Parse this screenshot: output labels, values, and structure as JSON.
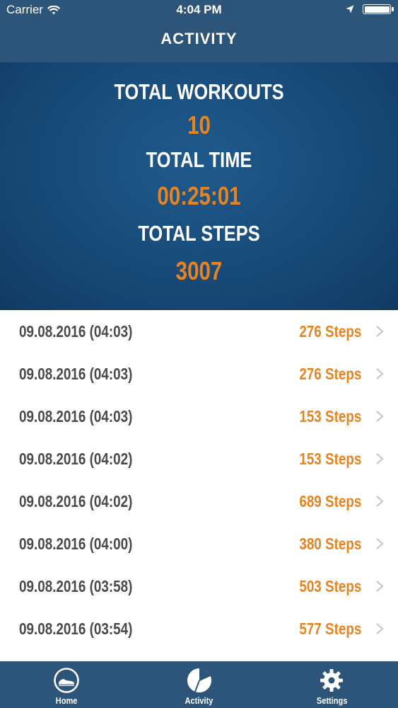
{
  "status_bar": {
    "carrier": "Carrier",
    "time": "4:04 PM"
  },
  "nav": {
    "title": "ACTIVITY"
  },
  "summary": {
    "total_workouts_label": "TOTAL WORKOUTS",
    "total_workouts_value": "10",
    "total_time_label": "TOTAL TIME",
    "total_time_value": "00:25:01",
    "total_steps_label": "TOTAL STEPS",
    "total_steps_value": "3007"
  },
  "workouts": [
    {
      "date": "09.08.2016 (04:03)",
      "steps": "276 Steps"
    },
    {
      "date": "09.08.2016 (04:03)",
      "steps": "276 Steps"
    },
    {
      "date": "09.08.2016 (04:03)",
      "steps": "153 Steps"
    },
    {
      "date": "09.08.2016 (04:02)",
      "steps": "153 Steps"
    },
    {
      "date": "09.08.2016 (04:02)",
      "steps": "689 Steps"
    },
    {
      "date": "09.08.2016 (04:00)",
      "steps": "380 Steps"
    },
    {
      "date": "09.08.2016 (03:58)",
      "steps": "503 Steps"
    },
    {
      "date": "09.08.2016 (03:54)",
      "steps": "577 Steps"
    }
  ],
  "tabs": [
    {
      "label": "Home",
      "icon": "shoe-icon"
    },
    {
      "label": "Activity",
      "icon": "pie-chart-icon"
    },
    {
      "label": "Settings",
      "icon": "gear-icon"
    }
  ],
  "colors": {
    "nav_background": "#2d5479",
    "header_background": "#174a78",
    "accent_orange": "#e8841f",
    "row_text": "#4a4a4a"
  }
}
